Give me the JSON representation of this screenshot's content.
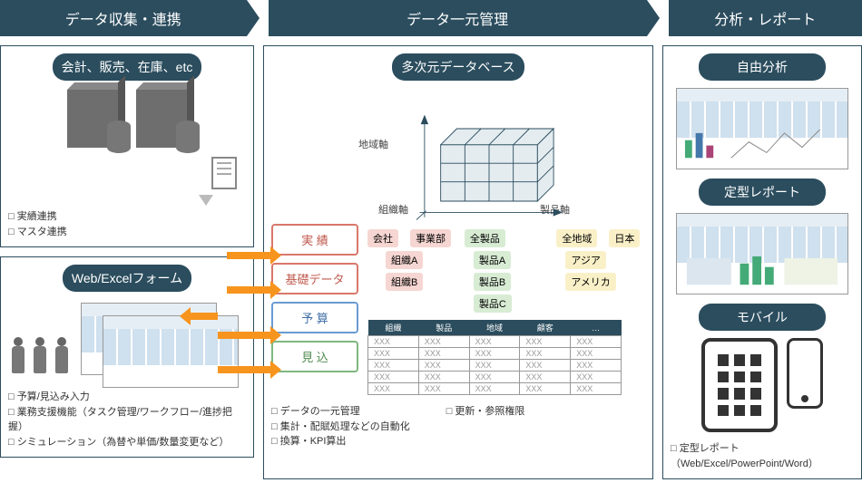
{
  "banners": {
    "collect": "データ収集・連携",
    "manage": "データ一元管理",
    "report": "分析・レポート"
  },
  "collect": {
    "sources_title": "会計、販売、在庫、etc",
    "source_checks": [
      "実績連携",
      "マスタ連携"
    ],
    "form_title": "Web/Excelフォーム",
    "form_checks": [
      "予算/見込み入力",
      "業務支援機能（タスク管理/ワークフロー/進捗把握）",
      "シミュレーション（為替や単価/数量変更など）"
    ]
  },
  "manage": {
    "cube_title": "多次元データベース",
    "axis": {
      "region": "地域軸",
      "org": "組織軸",
      "product": "製品軸"
    },
    "data_tags": {
      "actual": "実 績",
      "base": "基礎データ",
      "budget": "予 算",
      "forecast": "見 込"
    },
    "tree_company": {
      "root": "会社",
      "div": "事業部",
      "orgA": "組織A",
      "orgB": "組織B"
    },
    "tree_product": {
      "root": "全製品",
      "a": "製品A",
      "b": "製品B",
      "c": "製品C"
    },
    "tree_region": {
      "root": "全地域",
      "jp": "日本",
      "asia": "アジア",
      "us": "アメリカ"
    },
    "table": {
      "headers": [
        "組織",
        "製品",
        "地域",
        "顧客",
        "…"
      ],
      "cell": "XXX"
    },
    "checks_left": [
      "データの一元管理",
      "集計・配賦処理などの自動化",
      "換算・KPI算出"
    ],
    "checks_right": [
      "更新・参照権限"
    ]
  },
  "report": {
    "free_title": "自由分析",
    "fixed_title": "定型レポート",
    "mobile_title": "モバイル",
    "checks": [
      "定型レポート（Web/Excel/PowerPoint/Word）"
    ]
  }
}
